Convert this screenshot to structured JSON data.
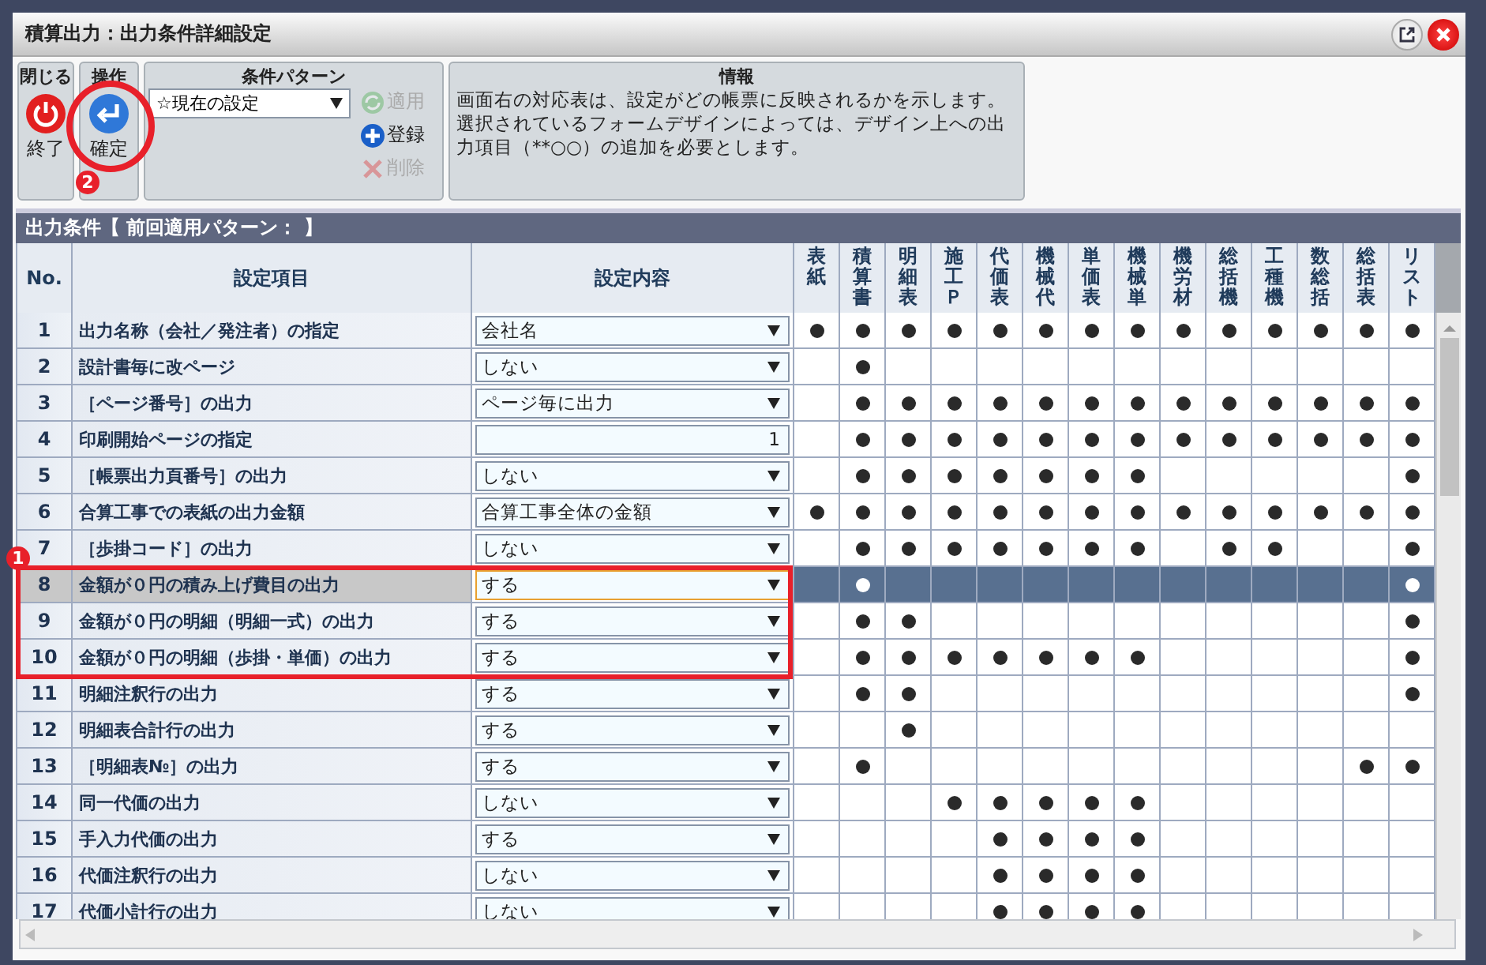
{
  "window": {
    "title": "積算出力：出力条件詳細設定"
  },
  "toolbar": {
    "close_group": {
      "title": "閉じる",
      "button": "終了"
    },
    "operation_group": {
      "title": "操作",
      "button": "確定"
    },
    "pattern_group": {
      "title": "条件パターン",
      "select": "☆現在の設定",
      "buttons": [
        {
          "label": "適用",
          "kind": "apply",
          "disabled": true
        },
        {
          "label": "登録",
          "kind": "register",
          "disabled": false
        },
        {
          "label": "削除",
          "kind": "delete",
          "disabled": true
        }
      ]
    },
    "info_group": {
      "title": "情報",
      "text": "画面右の対応表は、設定がどの帳票に反映されるかを示します。選択されているフォームデザインによっては、デザイン上への出力項目（**○○）の追加を必要とします。"
    }
  },
  "section": {
    "title": "出力条件【 前回適用パターン： 】"
  },
  "table": {
    "columns": [
      "No.",
      "設定項目",
      "設定内容"
    ],
    "forms": [
      "表紙",
      "積算書",
      "明細表",
      "施工Ｐ",
      "代価表",
      "機械代",
      "単価表",
      "機械単",
      "機労材",
      "総括機",
      "工種機",
      "数総括",
      "総括表",
      "リスト"
    ],
    "rows": [
      {
        "no": "1",
        "item": "出力名称（会社／発注者）の指定",
        "kind": "select",
        "value": "会社名",
        "selected": false,
        "boxed": false,
        "outputs": [
          true,
          true,
          true,
          true,
          true,
          true,
          true,
          true,
          true,
          true,
          true,
          true,
          true,
          true
        ]
      },
      {
        "no": "2",
        "item": "設計書毎に改ページ",
        "kind": "select",
        "value": "しない",
        "selected": false,
        "boxed": false,
        "outputs": [
          false,
          true,
          false,
          false,
          false,
          false,
          false,
          false,
          false,
          false,
          false,
          false,
          false,
          false
        ]
      },
      {
        "no": "3",
        "item": "［ページ番号］の出力",
        "kind": "select",
        "value": "ページ毎に出力",
        "selected": false,
        "boxed": false,
        "outputs": [
          false,
          true,
          true,
          true,
          true,
          true,
          true,
          true,
          true,
          true,
          true,
          true,
          true,
          true
        ]
      },
      {
        "no": "4",
        "item": "印刷開始ページの指定",
        "kind": "input",
        "value": "1",
        "selected": false,
        "boxed": false,
        "outputs": [
          false,
          true,
          true,
          true,
          true,
          true,
          true,
          true,
          true,
          true,
          true,
          true,
          true,
          true
        ]
      },
      {
        "no": "5",
        "item": "［帳票出力頁番号］の出力",
        "kind": "select",
        "value": "しない",
        "selected": false,
        "boxed": false,
        "outputs": [
          false,
          true,
          true,
          true,
          true,
          true,
          true,
          true,
          false,
          false,
          false,
          false,
          false,
          true
        ]
      },
      {
        "no": "6",
        "item": "合算工事での表紙の出力金額",
        "kind": "select",
        "value": "合算工事全体の金額",
        "selected": false,
        "boxed": false,
        "outputs": [
          true,
          true,
          true,
          true,
          true,
          true,
          true,
          true,
          true,
          true,
          true,
          true,
          true,
          true
        ]
      },
      {
        "no": "7",
        "item": "［歩掛コード］の出力",
        "kind": "select",
        "value": "しない",
        "selected": false,
        "boxed": false,
        "outputs": [
          false,
          true,
          true,
          true,
          true,
          true,
          true,
          true,
          false,
          true,
          true,
          false,
          false,
          true
        ]
      },
      {
        "no": "8",
        "item": "金額が０円の積み上げ費目の出力",
        "kind": "select",
        "value": "する",
        "selected": true,
        "boxed": true,
        "outputs": [
          false,
          true,
          false,
          false,
          false,
          false,
          false,
          false,
          false,
          false,
          false,
          false,
          false,
          true
        ]
      },
      {
        "no": "9",
        "item": "金額が０円の明細（明細一式）の出力",
        "kind": "select",
        "value": "する",
        "selected": false,
        "boxed": true,
        "outputs": [
          false,
          true,
          true,
          false,
          false,
          false,
          false,
          false,
          false,
          false,
          false,
          false,
          false,
          true
        ]
      },
      {
        "no": "10",
        "item": "金額が０円の明細（歩掛・単価）の出力",
        "kind": "select",
        "value": "する",
        "selected": false,
        "boxed": true,
        "outputs": [
          false,
          true,
          true,
          true,
          true,
          true,
          true,
          true,
          false,
          false,
          false,
          false,
          false,
          true
        ]
      },
      {
        "no": "11",
        "item": "明細注釈行の出力",
        "kind": "select",
        "value": "する",
        "selected": false,
        "boxed": false,
        "outputs": [
          false,
          true,
          true,
          false,
          false,
          false,
          false,
          false,
          false,
          false,
          false,
          false,
          false,
          true
        ]
      },
      {
        "no": "12",
        "item": "明細表合計行の出力",
        "kind": "select",
        "value": "する",
        "selected": false,
        "boxed": false,
        "outputs": [
          false,
          false,
          true,
          false,
          false,
          false,
          false,
          false,
          false,
          false,
          false,
          false,
          false,
          false
        ]
      },
      {
        "no": "13",
        "item": "［明細表№］の出力",
        "kind": "select",
        "value": "する",
        "selected": false,
        "boxed": false,
        "outputs": [
          false,
          true,
          false,
          false,
          false,
          false,
          false,
          false,
          false,
          false,
          false,
          false,
          true,
          true
        ]
      },
      {
        "no": "14",
        "item": "同一代価の出力",
        "kind": "select",
        "value": "しない",
        "selected": false,
        "boxed": false,
        "outputs": [
          false,
          false,
          false,
          true,
          true,
          true,
          true,
          true,
          false,
          false,
          false,
          false,
          false,
          false
        ]
      },
      {
        "no": "15",
        "item": "手入力代価の出力",
        "kind": "select",
        "value": "する",
        "selected": false,
        "boxed": false,
        "outputs": [
          false,
          false,
          false,
          false,
          true,
          true,
          true,
          true,
          false,
          false,
          false,
          false,
          false,
          false
        ]
      },
      {
        "no": "16",
        "item": "代価注釈行の出力",
        "kind": "select",
        "value": "しない",
        "selected": false,
        "boxed": false,
        "outputs": [
          false,
          false,
          false,
          false,
          true,
          true,
          true,
          true,
          false,
          false,
          false,
          false,
          false,
          false
        ]
      },
      {
        "no": "17",
        "item": "代価小計行の出力",
        "kind": "select",
        "value": "しない",
        "selected": false,
        "boxed": false,
        "outputs": [
          false,
          false,
          false,
          false,
          true,
          true,
          true,
          true,
          false,
          false,
          false,
          false,
          false,
          false
        ]
      }
    ]
  },
  "annotations": [
    {
      "kind": "rows_box",
      "label": "1"
    },
    {
      "kind": "button_circle",
      "label": "2"
    }
  ]
}
